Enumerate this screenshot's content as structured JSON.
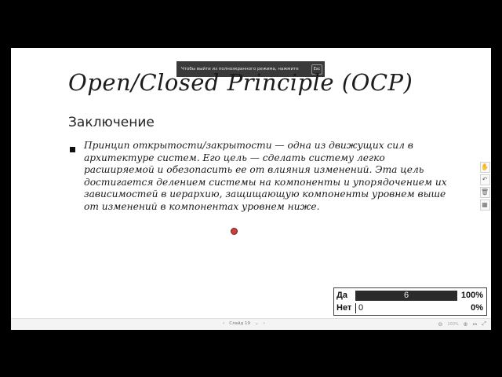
{
  "fullscreen_notice": {
    "text": "Чтобы выйти из полноэкранного режима, нажмите",
    "key": "Esc"
  },
  "slide": {
    "title": "Open/Closed Principle (OCP)",
    "subtitle": "Заключение",
    "bullet": "Принцип открытости/закрытости — одна из движущих сил в архитектуре систем. Его цель — сделать систему легко расширяемой и обезопасить ее от влияния изменений. Эта цель достигается делением системы на компоненты и упорядочением их зависимостей в иерархию, защищающую компоненты уровнем выше от изменений в компонентах уровнем ниже."
  },
  "side_tools": {
    "hand": "✋",
    "undo": "↶",
    "trash": "🗑",
    "chart": "▦"
  },
  "poll": {
    "rows": [
      {
        "label": "Да",
        "count": "6",
        "percent": "100%",
        "fraction": 1.0
      },
      {
        "label": "Нет",
        "count": "0",
        "percent": "0%",
        "fraction": 0.0
      }
    ]
  },
  "bottom_bar": {
    "prev": "‹",
    "slide_label": "Слайд 19",
    "dropdown": "⌄",
    "next": "›",
    "zoom_out": "⊖",
    "zoom_level": "100%",
    "zoom_in": "⊕",
    "fit": "↔",
    "fullscreen": "⤢"
  }
}
